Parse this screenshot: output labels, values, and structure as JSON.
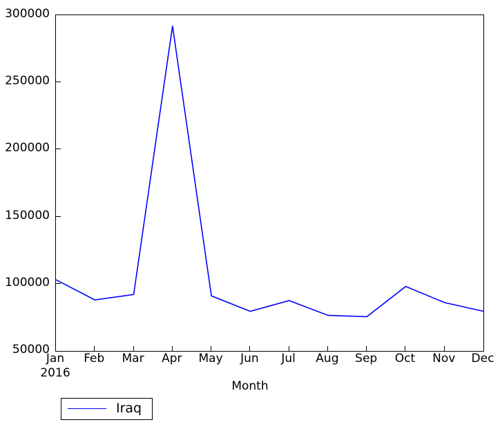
{
  "chart_data": {
    "type": "line",
    "title": "",
    "xlabel": "Month",
    "ylabel": "",
    "categories": [
      "Jan",
      "Feb",
      "Mar",
      "Apr",
      "May",
      "Jun",
      "Jul",
      "Aug",
      "Sep",
      "Oct",
      "Nov",
      "Dec"
    ],
    "x_year_label": "2016",
    "series": [
      {
        "name": "Iraq",
        "color": "#0000ff",
        "values": [
          103000,
          88000,
          92000,
          292000,
          91000,
          79500,
          87500,
          76500,
          75500,
          98000,
          86000,
          79500
        ]
      }
    ],
    "ylim": [
      50000,
      300000
    ],
    "yticks": [
      50000,
      100000,
      150000,
      200000,
      250000,
      300000
    ],
    "ytick_labels": [
      "50000",
      "100000",
      "150000",
      "200000",
      "250000",
      "300000"
    ],
    "xlim_index": [
      0,
      11
    ],
    "grid": false,
    "legend_position": "below-left",
    "legend_entries": [
      "Iraq"
    ]
  },
  "axis": {
    "x_title": "Month"
  }
}
